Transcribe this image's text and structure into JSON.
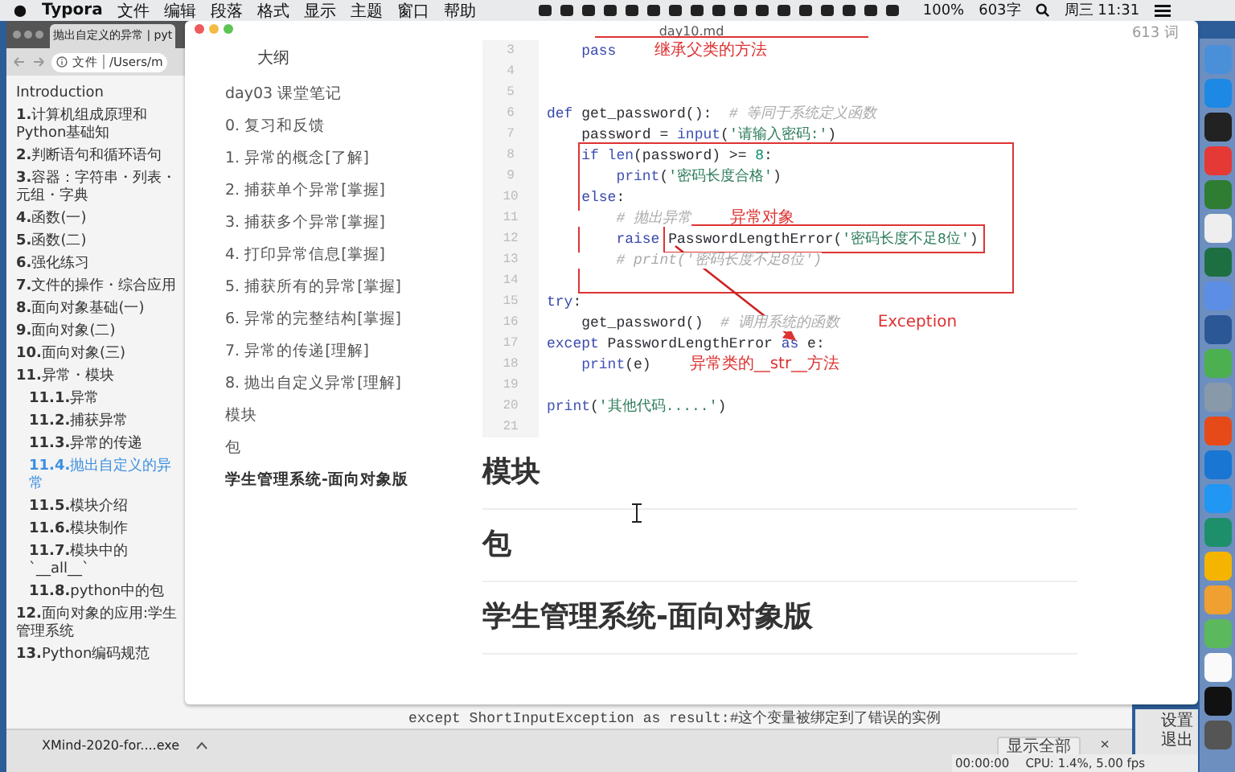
{
  "menu_bar": {
    "app": "Typora",
    "menus": [
      "文件",
      "编辑",
      "段落",
      "格式",
      "显示",
      "主题",
      "窗口",
      "帮助"
    ],
    "battery": "100%",
    "word_count": "603字",
    "clock": "周三 11:31"
  },
  "browser": {
    "tab_title": "抛出自定义的异常 | pyt",
    "address_scheme": "文件",
    "address": "/Users/m",
    "nav": [
      {
        "label": "Introduction",
        "selected": false
      },
      {
        "num": "1.",
        "label": "计算机组成原理和Python基础知",
        "selected": false
      },
      {
        "num": "2.",
        "label": "判断语句和循环语句",
        "selected": false
      },
      {
        "num": "3.",
        "label": "容器：字符串・列表・元组・字典",
        "selected": false
      },
      {
        "num": "4.",
        "label": "函数(一)",
        "selected": false
      },
      {
        "num": "5.",
        "label": "函数(二)",
        "selected": false
      },
      {
        "num": "6.",
        "label": "强化练习",
        "selected": false
      },
      {
        "num": "7.",
        "label": "文件的操作・综合应用",
        "selected": false
      },
      {
        "num": "8.",
        "label": "面向对象基础(一)",
        "selected": false
      },
      {
        "num": "9.",
        "label": "面向对象(二)",
        "selected": false
      },
      {
        "num": "10.",
        "label": "面向对象(三)",
        "selected": false
      },
      {
        "num": "11.",
        "label": "异常・模块",
        "selected": false,
        "children": [
          {
            "num": "11.1.",
            "label": "异常",
            "selected": false
          },
          {
            "num": "11.2.",
            "label": "捕获异常",
            "selected": false
          },
          {
            "num": "11.3.",
            "label": "异常的传递",
            "selected": false
          },
          {
            "num": "11.4.",
            "label": "抛出自定义的异常",
            "selected": true
          },
          {
            "num": "11.5.",
            "label": "模块介绍",
            "selected": false
          },
          {
            "num": "11.6.",
            "label": "模块制作",
            "selected": false
          },
          {
            "num": "11.7.",
            "label": "模块中的`__all__`",
            "selected": false
          },
          {
            "num": "11.8.",
            "label": "python中的包",
            "selected": false
          }
        ]
      },
      {
        "num": "12.",
        "label": "面向对象的应用:学生管理系统",
        "selected": false
      },
      {
        "num": "13.",
        "label": "Python编码规范",
        "selected": false
      }
    ],
    "page_text": "except ShortInputException as result:#这个变量被绑定到了错误的实例"
  },
  "downloads": {
    "file": "XMind-2020-for....exe",
    "show_all": "显示全部",
    "close": "×"
  },
  "recorder": {
    "settings": "设置",
    "exit": "退出",
    "time": "00:00:00",
    "stats": "CPU: 1.4%, 5.00 fps"
  },
  "editor": {
    "file_name": "day10.md",
    "word_count": "613 词",
    "outline_title": "大纲",
    "outline": [
      {
        "label": "day03 课堂笔记",
        "selected": false
      },
      {
        "label": "0. 复习和反馈",
        "selected": false
      },
      {
        "label": "1. 异常的概念[了解]",
        "selected": false
      },
      {
        "label": "2. 捕获单个异常[掌握]",
        "selected": false
      },
      {
        "label": "3. 捕获多个异常[掌握]",
        "selected": false
      },
      {
        "label": "4. 打印异常信息[掌握]",
        "selected": false
      },
      {
        "label": "5. 捕获所有的异常[掌握]",
        "selected": false
      },
      {
        "label": "6. 异常的完整结构[掌握]",
        "selected": false
      },
      {
        "label": "7. 异常的传递[理解]",
        "selected": false
      },
      {
        "label": "8. 抛出自定义异常[理解]",
        "selected": false
      },
      {
        "label": "模块",
        "selected": false
      },
      {
        "label": "包",
        "selected": false
      },
      {
        "label": "学生管理系统-面向对象版",
        "selected": true
      }
    ],
    "code": [
      {
        "number": "3",
        "tokens": [
          {
            "kind": "kw",
            "text": "    pass"
          }
        ],
        "note": {
          "kind": "inline",
          "text": "继承父类的方法"
        }
      },
      {
        "number": "4"
      },
      {
        "number": "5"
      },
      {
        "number": "6",
        "tokens": [
          {
            "kind": "kw",
            "text": "def"
          },
          {
            "kind": "plain",
            "text": " get_password():  "
          },
          {
            "kind": "cm",
            "text": "# 等同于系统定义函数"
          }
        ]
      },
      {
        "number": "7",
        "tokens": [
          {
            "kind": "plain",
            "text": "    password = "
          },
          {
            "kind": "fn",
            "text": "input"
          },
          {
            "kind": "plain",
            "text": "("
          },
          {
            "kind": "str",
            "text": "'请输入密码:'"
          },
          {
            "kind": "plain",
            "text": ")"
          }
        ]
      },
      {
        "number": "8",
        "tokens": [
          {
            "kind": "kw",
            "text": "    if"
          },
          {
            "kind": "fn",
            "text": " len"
          },
          {
            "kind": "plain",
            "text": "(password) >= "
          },
          {
            "kind": "num",
            "text": "8"
          },
          {
            "kind": "plain",
            "text": ":"
          }
        ]
      },
      {
        "number": "9",
        "tokens": [
          {
            "kind": "fn",
            "text": "        print"
          },
          {
            "kind": "plain",
            "text": "("
          },
          {
            "kind": "str",
            "text": "'密码长度合格'"
          },
          {
            "kind": "plain",
            "text": ")"
          }
        ]
      },
      {
        "number": "10",
        "tokens": [
          {
            "kind": "kw",
            "text": "    else"
          },
          {
            "kind": "plain",
            "text": ":"
          }
        ]
      },
      {
        "number": "11",
        "tokens": [
          {
            "kind": "cm",
            "text": "        # 抛出异常"
          }
        ],
        "note": {
          "kind": "inline",
          "text": "异常对象"
        }
      },
      {
        "number": "12",
        "tokens": [
          {
            "kind": "kw",
            "text": "        raise"
          },
          {
            "kind": "plain",
            "text": " PasswordLengthError("
          },
          {
            "kind": "str",
            "text": "'密码长度不足8位'"
          },
          {
            "kind": "plain",
            "text": ")"
          }
        ]
      },
      {
        "number": "13",
        "tokens": [
          {
            "kind": "cm",
            "text": "        # print('密码长度不足8位')"
          }
        ]
      },
      {
        "number": "14"
      },
      {
        "number": "15",
        "tokens": [
          {
            "kind": "kw",
            "text": "try"
          },
          {
            "kind": "plain",
            "text": ":"
          }
        ]
      },
      {
        "number": "16",
        "tokens": [
          {
            "kind": "plain",
            "text": "    get_password()  "
          },
          {
            "kind": "cm",
            "text": "# 调用系统的函数"
          }
        ],
        "note": {
          "kind": "inline",
          "text": "Exception"
        }
      },
      {
        "number": "17",
        "tokens": [
          {
            "kind": "kw",
            "text": "except"
          },
          {
            "kind": "plain",
            "text": " PasswordLengthError "
          },
          {
            "kind": "kw",
            "text": "as"
          },
          {
            "kind": "plain",
            "text": " e:"
          }
        ]
      },
      {
        "number": "18",
        "tokens": [
          {
            "kind": "fn",
            "text": "    print"
          },
          {
            "kind": "plain",
            "text": "(e)"
          }
        ],
        "note": {
          "kind": "inline",
          "text": "异常类的__str__方法"
        }
      },
      {
        "number": "19"
      },
      {
        "number": "20",
        "tokens": [
          {
            "kind": "fn",
            "text": "print"
          },
          {
            "kind": "plain",
            "text": "("
          },
          {
            "kind": "str",
            "text": "'其他代码.....'"
          },
          {
            "kind": "plain",
            "text": ")"
          }
        ]
      },
      {
        "number": "21"
      }
    ],
    "headings": [
      "模块",
      "包",
      "学生管理系统-面向对象版"
    ]
  }
}
